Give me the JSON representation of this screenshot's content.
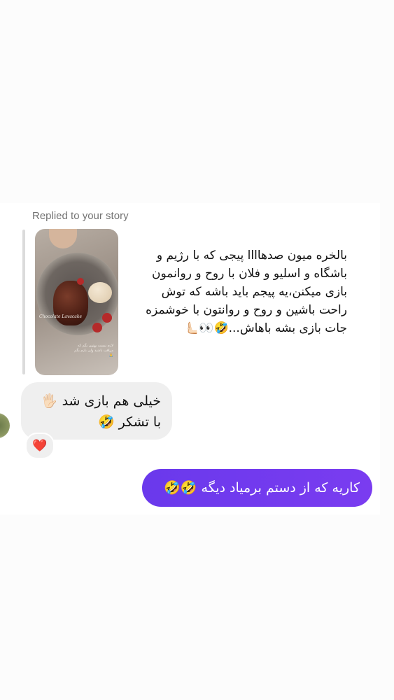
{
  "story_reply": {
    "label": "Replied to your story",
    "thumbnail": {
      "caption": "Chocolate Lavacake",
      "overlay_text": "لازم نیست بهتون بگم که مراقب باشید ولی بازم بگم 🙏"
    },
    "message": "بالخره میون صدهاااا پیجی که با رژیم و باشگاه و اسلیو و فلان با روح و روانمون بازی میکنن،یه پیجم باید باشه که توش راحت باشین و روح و روانتون با خوشمزه جات بازی بشه باهاش...🤣👀🫷🏻"
  },
  "incoming": {
    "text": "خیلی هم بازی شد 🖐🏻\nبا تشکر 🤣",
    "reaction": "❤️"
  },
  "outgoing": {
    "text": "کاریه که از دستم برمیاد دیگه 🤣🤣"
  },
  "colors": {
    "outgoing_bubble": "#7a3cf0",
    "incoming_bubble": "#efefef",
    "background": "#fcfcfc"
  }
}
